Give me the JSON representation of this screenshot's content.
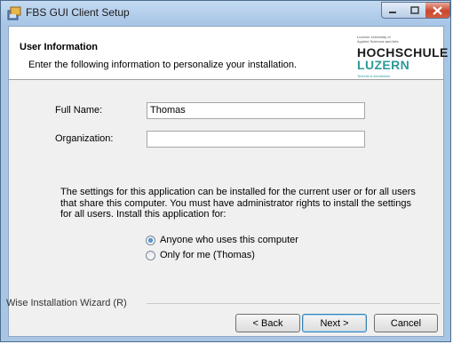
{
  "window": {
    "title": "FBS GUI Client Setup",
    "icons": {
      "app": "setup-icon",
      "minimize": "minimize-icon",
      "maximize": "maximize-icon",
      "close": "close-icon"
    }
  },
  "header": {
    "title": "User Information",
    "subtitle": "Enter the following information to personalize your installation.",
    "logo": {
      "small_line1": "Lucerne University of",
      "small_line2": "Applied Sciences and Arts",
      "line1": "HOCHSCHULE",
      "line2": "LUZERN",
      "department": "Technik & Architektur"
    }
  },
  "form": {
    "full_name_label": "Full Name:",
    "full_name_value": "Thomas",
    "organization_label": "Organization:",
    "organization_value": ""
  },
  "info_text": "The settings for this application can be installed for the current user or for all users that share this computer. You must have administrator rights to install the settings for all users. Install this application for:",
  "install_scope": {
    "options": [
      {
        "label": "Anyone who uses this computer",
        "checked": true
      },
      {
        "label": "Only for me (Thomas)",
        "checked": false
      }
    ]
  },
  "footer": {
    "wizard_name": "Wise Installation Wizard (R)",
    "back_label": "< Back",
    "next_label": "Next >",
    "cancel_label": "Cancel"
  },
  "colors": {
    "accent": "#2f9a9a",
    "title_bar": "#a6c4e6",
    "close_button": "#c8472e"
  }
}
